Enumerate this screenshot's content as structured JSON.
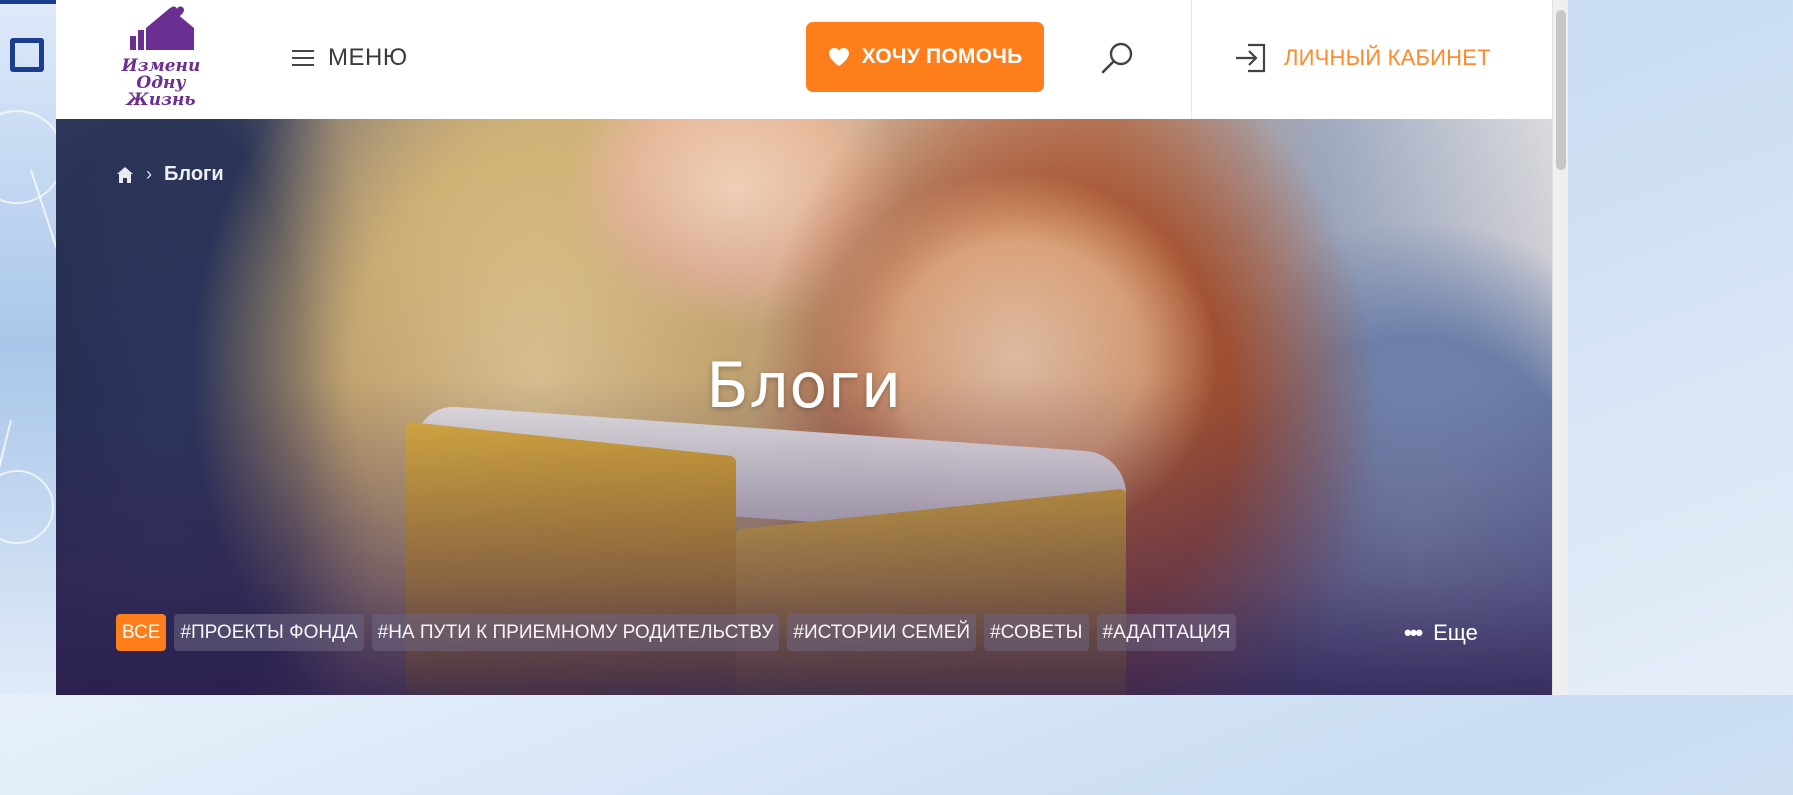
{
  "logo": {
    "lines": [
      "Измени",
      "Одну",
      "Жизнь"
    ]
  },
  "header": {
    "menu_label": "МЕНЮ",
    "help_label": "ХОЧУ ПОМОЧЬ",
    "cabinet_label": "ЛИЧНЫЙ КАБИНЕТ"
  },
  "breadcrumb": {
    "sep": "›",
    "current": "Блоги"
  },
  "hero": {
    "title": "Блоги"
  },
  "tags": [
    "ВСЕ",
    "#ПРОЕКТЫ ФОНДА",
    "#НА ПУТИ К ПРИЕМНОМУ РОДИТЕЛЬСТВУ",
    "#ИСТОРИИ СЕМЕЙ",
    "#СОВЕТЫ",
    "#АДАПТАЦИЯ"
  ],
  "more": {
    "dots": "•••",
    "label": "Еще"
  },
  "colors": {
    "accent": "#ff7e1c",
    "brand": "#6b2f91",
    "cabinet": "#ff8a2a"
  },
  "icons": {
    "menu": "hamburger-icon",
    "help": "heart-icon",
    "search": "search-icon",
    "cabinet": "login-icon",
    "home": "home-icon"
  }
}
